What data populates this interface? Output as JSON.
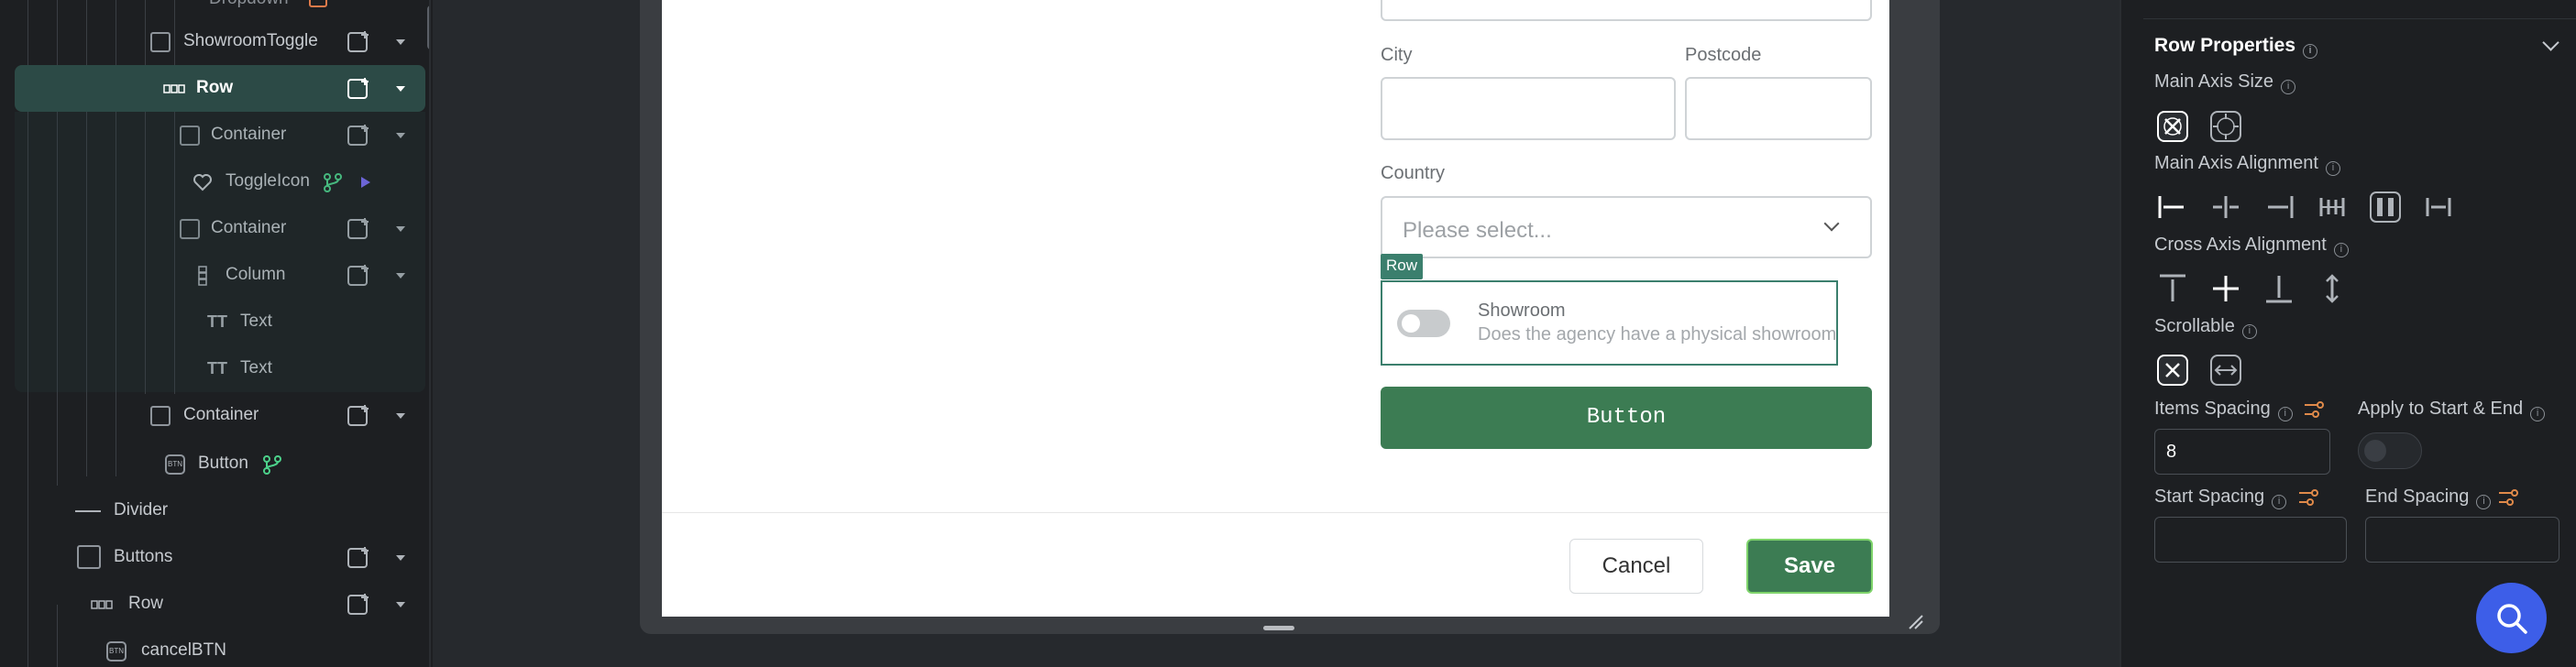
{
  "tree": {
    "items": [
      {
        "label": "Dropdown"
      },
      {
        "label": "ShowroomToggle"
      },
      {
        "label": "Row"
      },
      {
        "label": "Container"
      },
      {
        "label": "ToggleIcon"
      },
      {
        "label": "Container"
      },
      {
        "label": "Column"
      },
      {
        "label": "Text"
      },
      {
        "label": "Text"
      },
      {
        "label": "Container"
      },
      {
        "label": "Button"
      },
      {
        "label": "Divider"
      },
      {
        "label": "Buttons"
      },
      {
        "label": "Row"
      },
      {
        "label": "cancelBTN"
      }
    ]
  },
  "form": {
    "city_label": "City",
    "postcode_label": "Postcode",
    "country_label": "Country",
    "country_placeholder": "Please select...",
    "row_tag": "Row",
    "showroom_title": "Showroom",
    "showroom_subtitle": "Does the agency have a physical showroom?",
    "button_label": "Button",
    "cancel_label": "Cancel",
    "save_label": "Save"
  },
  "props": {
    "section_title": "Row Properties",
    "main_axis_size": "Main Axis Size",
    "main_axis_alignment": "Main Axis Alignment",
    "cross_axis_alignment": "Cross Axis Alignment",
    "scrollable": "Scrollable",
    "items_spacing": "Items Spacing",
    "items_spacing_value": "8",
    "apply_to_start_end": "Apply to Start & End",
    "start_spacing": "Start Spacing",
    "end_spacing": "End Spacing",
    "start_spacing_value": "",
    "end_spacing_value": ""
  },
  "colors": {
    "accent_green": "#3c7c53",
    "selection_teal": "#2c4a46",
    "search_blue": "#3d5ee8"
  }
}
